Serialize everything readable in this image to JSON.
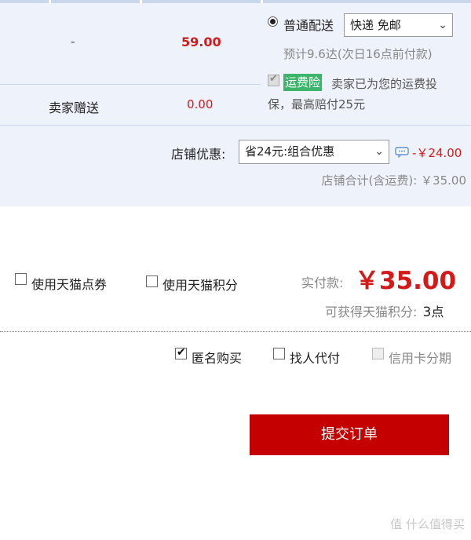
{
  "row1": {
    "dash": "-",
    "price": "59.00"
  },
  "row2": {
    "label": "卖家赠送",
    "amount": "0.00"
  },
  "shipping": {
    "option_label": "普通配送",
    "select_value": "快递 免邮",
    "estimate": "预计9.6达(次日16点前付款)",
    "insurance_tag": "运费险",
    "insurance_text_line1": "卖家已为您的运费投",
    "insurance_text_line2": "保，最高赔付25元"
  },
  "store": {
    "discount_label": "店铺优惠:",
    "discount_select": "省24元:组合优惠",
    "discount_amount": "-￥24.00",
    "subtotal": "店铺合计(含运费): ￥35.00"
  },
  "payment": {
    "coupon_label": "使用天猫点券",
    "points_label": "使用天猫积分",
    "actual_label": "实付款:",
    "actual_amount": "￥35.00",
    "earn_label": "可获得天猫积分:",
    "earn_points": "3",
    "earn_unit": "点"
  },
  "options": {
    "anonymous": "匿名购买",
    "proxy_pay": "找人代付",
    "installment": "信用卡分期"
  },
  "submit_label": "提交订单",
  "watermark": "值 什么值得买",
  "colors": {
    "accent_red": "#c40000",
    "price_red": "#d41919",
    "panel_bg": "#eef3fb",
    "insurance_green": "#3bb56a"
  }
}
